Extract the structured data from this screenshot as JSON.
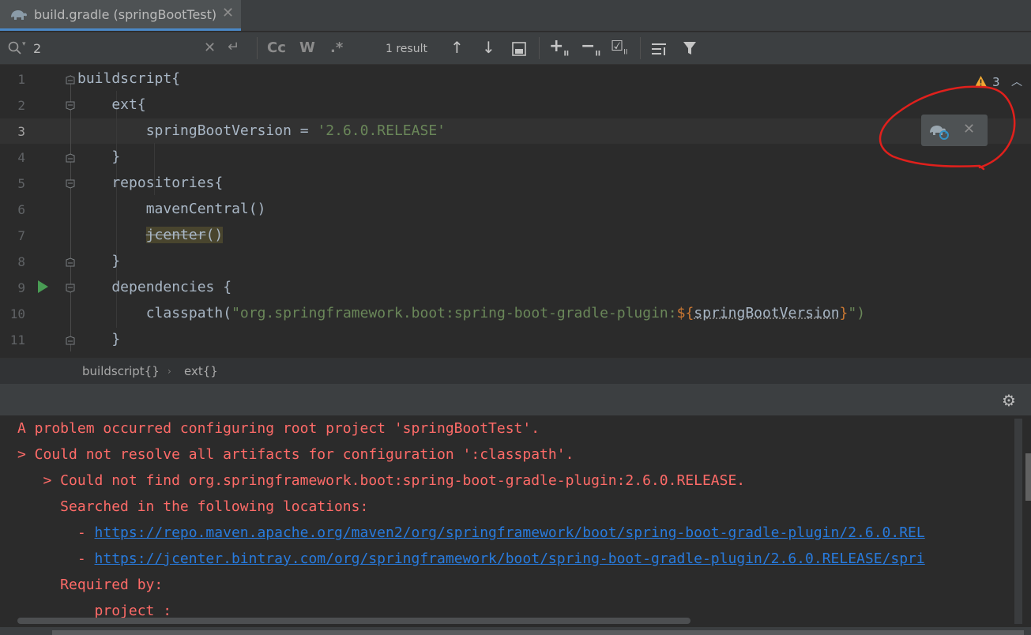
{
  "tab": {
    "title": "build.gradle (springBootTest)"
  },
  "search": {
    "query": "2",
    "case_label": "Cc",
    "word_label": "W",
    "regex_label": ".*",
    "result_count": "1 result"
  },
  "editor": {
    "line_numbers": [
      "1",
      "2",
      "3",
      "4",
      "5",
      "6",
      "7",
      "8",
      "9",
      "10",
      "11"
    ],
    "lines": {
      "l1": "buildscript{",
      "l2": "    ext{",
      "l3_prefix": "        springBootVersion = ",
      "l3_string": "'2.6.0.RELEASE'",
      "l4": "    }",
      "l5": "    repositories{",
      "l6": "        mavenCentral()",
      "l7_indent": "        ",
      "l7_name": "jcenter",
      "l7_suffix": "()",
      "l8": "    }",
      "l9": "    dependencies {",
      "l10_prefix": "        classpath(",
      "l10_string_a": "\"org.springframework.boot:spring-boot-gradle-plugin:",
      "l10_interp_open": "${",
      "l10_var": "springBootVersion",
      "l10_interp_close": "}",
      "l10_string_b": "\")",
      "l11": "    }"
    },
    "warning_count": "3"
  },
  "breadcrumb": {
    "items": [
      "buildscript{}",
      "ext{}"
    ]
  },
  "console": {
    "lines": [
      "A problem occurred configuring root project 'springBootTest'.",
      "> Could not resolve all artifacts for configuration ':classpath'.",
      "   > Could not find org.springframework.boot:spring-boot-gradle-plugin:2.6.0.RELEASE.",
      "     Searched in the following locations:",
      "       - ",
      "       - ",
      "     Required by:",
      "         project :"
    ],
    "links": [
      "https://repo.maven.apache.org/maven2/org/springframework/boot/spring-boot-gradle-plugin/2.6.0.REL",
      "https://jcenter.bintray.com/org/springframework/boot/spring-boot-gradle-plugin/2.6.0.RELEASE/spri"
    ]
  },
  "colors": {
    "accent": "#4a88c7",
    "error": "#ff6b68",
    "link": "#287bde",
    "annotation": "#e0201c"
  }
}
